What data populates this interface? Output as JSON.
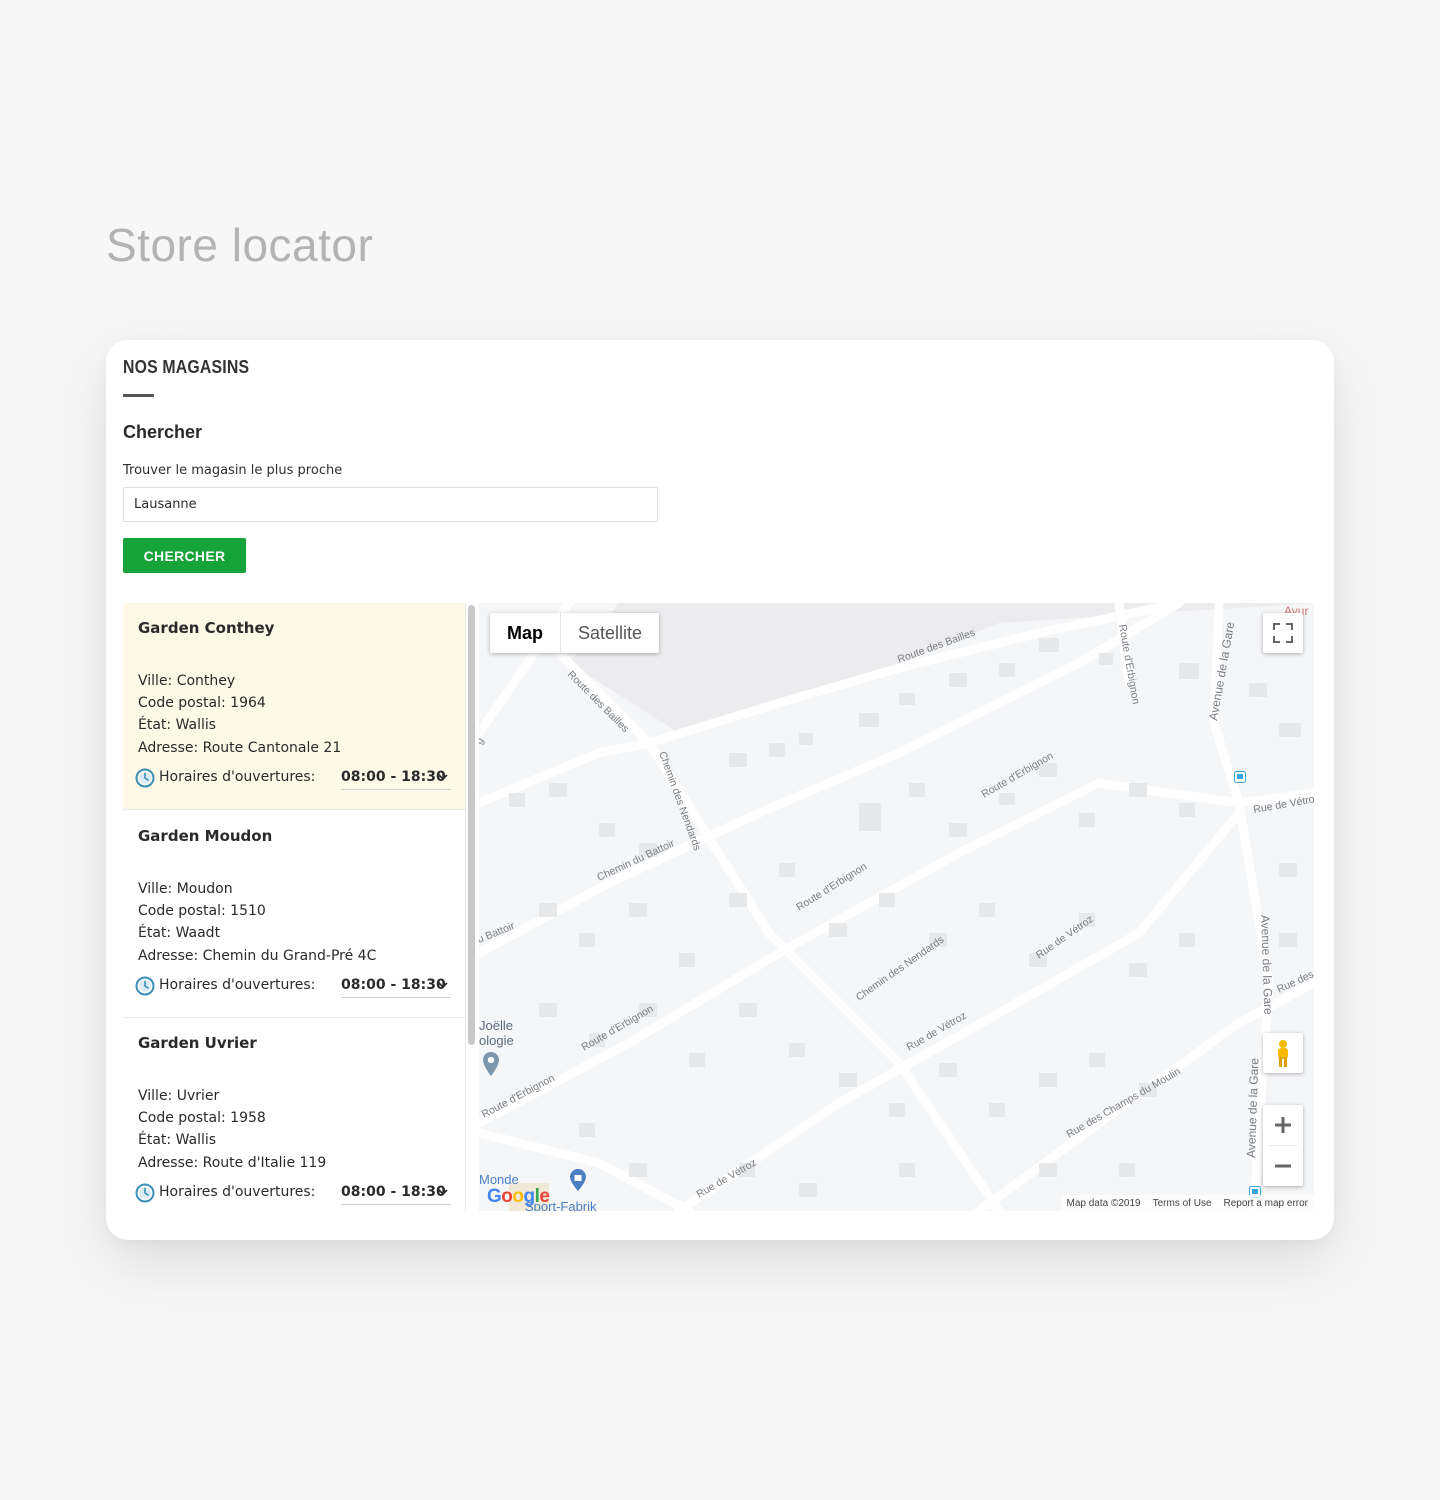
{
  "page": {
    "title": "Store locator"
  },
  "panel": {
    "heading": "NOS MAGASINS",
    "search_title": "Chercher",
    "search_label": "Trouver le magasin le plus proche",
    "search_value": "Lausanne",
    "search_button": "CHERCHER"
  },
  "stores": [
    {
      "name": "Garden Conthey",
      "city": "Ville: Conthey",
      "postal": "Code postal: 1964",
      "state": "État: Wallis",
      "address": "Adresse: Route Cantonale 21",
      "hours_label": "Horaires d'ouvertures:",
      "hours": "08:00 - 18:30",
      "selected": true
    },
    {
      "name": "Garden Moudon",
      "city": "Ville: Moudon",
      "postal": "Code postal: 1510",
      "state": "État: Waadt",
      "address": "Adresse: Chemin du Grand-Pré 4C",
      "hours_label": "Horaires d'ouvertures:",
      "hours": "08:00 - 18:30",
      "selected": false
    },
    {
      "name": "Garden Uvrier",
      "city": "Ville: Uvrier",
      "postal": "Code postal: 1958",
      "state": "État: Wallis",
      "address": "Adresse: Route d'Italie 119",
      "hours_label": "Horaires d'ouvertures:",
      "hours": "08:00 - 18:30",
      "selected": false
    }
  ],
  "map": {
    "type_map": "Map",
    "type_satellite": "Satellite",
    "google_logo": "Google",
    "attribution": {
      "data": "Map data ©2019",
      "terms": "Terms of Use",
      "report": "Report a map error"
    },
    "streets": [
      "Route des Bailles",
      "Route des Bailles",
      "Route d'Erbignon",
      "Avenue de la Gare",
      "Chemin des Nendards",
      "Chemin du Battoir",
      "Route d'Erbignon",
      "Route d'Erbignon",
      "Rue de Vétro",
      "Rue de Vétroz",
      "Chemin des Nendards",
      "Route d'Erbignon",
      "Rue de Vétroz",
      "Route d'Erbignon",
      "Rue des Champs du Moulin",
      "Rue de Vétroz",
      "Avenue de la Gare",
      "Avenue de la Gare",
      "u Battoir",
      "Rue des",
      "g"
    ],
    "pois": [
      "Joëlle",
      "ologie",
      "Monde",
      "Sport-Fabrik",
      "Ayur"
    ]
  },
  "colors": {
    "accent_green": "#16a33a",
    "selected_bg": "#fef8e7",
    "clock_icon": "#3a8fb7"
  },
  "icons": [
    "clock-icon",
    "chevron-down-icon",
    "fullscreen-icon",
    "pegman-icon",
    "zoom-in-icon",
    "zoom-out-icon",
    "map-pin-icon",
    "shopping-bag-icon",
    "bus-stop-icon"
  ]
}
